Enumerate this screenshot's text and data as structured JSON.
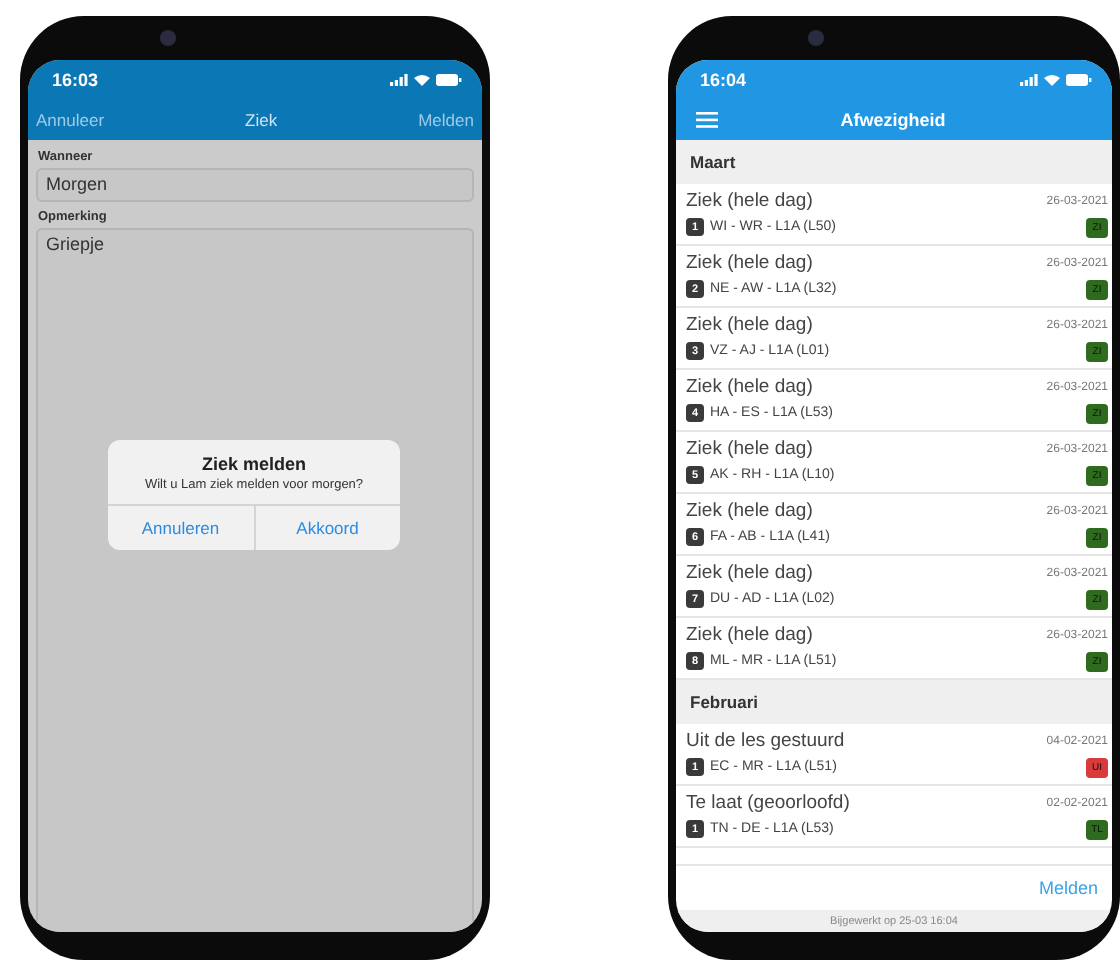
{
  "sick_report_screen": {
    "status_time": "16:03",
    "nav": {
      "cancel": "Annuleer",
      "title": "Ziek",
      "submit": "Melden"
    },
    "fields": [
      {
        "label": "Wanneer",
        "value": "Morgen",
        "kind": "input"
      },
      {
        "label": "Opmerking",
        "value": "Griepje",
        "kind": "textarea"
      }
    ],
    "dialog": {
      "title": "Ziek melden",
      "message": "Wilt u Lam ziek melden voor morgen?",
      "buttons": [
        "Annuleren",
        "Akkoord"
      ]
    }
  },
  "absence_screen": {
    "status_time": "16:04",
    "title": "Afwezigheid",
    "sections": [
      {
        "heading": "Maart",
        "items": [
          {
            "title": "Ziek (hele dag)",
            "number": "1",
            "detail": "WI - WR - L1A (L50)",
            "date": "26-03-2021",
            "code": "ZI",
            "color": "#2e6b1f"
          },
          {
            "title": "Ziek (hele dag)",
            "number": "2",
            "detail": "NE - AW - L1A (L32)",
            "date": "26-03-2021",
            "code": "ZI",
            "color": "#2e6b1f"
          },
          {
            "title": "Ziek (hele dag)",
            "number": "3",
            "detail": "VZ - AJ - L1A (L01)",
            "date": "26-03-2021",
            "code": "ZI",
            "color": "#2e6b1f"
          },
          {
            "title": "Ziek (hele dag)",
            "number": "4",
            "detail": "HA - ES - L1A (L53)",
            "date": "26-03-2021",
            "code": "ZI",
            "color": "#2e6b1f"
          },
          {
            "title": "Ziek (hele dag)",
            "number": "5",
            "detail": "AK - RH - L1A (L10)",
            "date": "26-03-2021",
            "code": "ZI",
            "color": "#2e6b1f"
          },
          {
            "title": "Ziek (hele dag)",
            "number": "6",
            "detail": "FA - AB - L1A (L41)",
            "date": "26-03-2021",
            "code": "ZI",
            "color": "#2e6b1f"
          },
          {
            "title": "Ziek (hele dag)",
            "number": "7",
            "detail": "DU - AD - L1A (L02)",
            "date": "26-03-2021",
            "code": "ZI",
            "color": "#2e6b1f"
          },
          {
            "title": "Ziek (hele dag)",
            "number": "8",
            "detail": "ML - MR - L1A (L51)",
            "date": "26-03-2021",
            "code": "ZI",
            "color": "#2e6b1f"
          }
        ]
      },
      {
        "heading": "Februari",
        "items": [
          {
            "title": "Uit de les gestuurd",
            "number": "1",
            "detail": "EC - MR - L1A (L51)",
            "date": "04-02-2021",
            "code": "UI",
            "color": "#d93a3a"
          },
          {
            "title": "Te laat (geoorloofd)",
            "number": "1",
            "detail": "TN - DE - L1A (L53)",
            "date": "02-02-2021",
            "code": "TL",
            "color": "#2e6b1f"
          }
        ]
      }
    ],
    "action": "Melden",
    "updated": "Bijgewerkt op 25-03 16:04"
  }
}
